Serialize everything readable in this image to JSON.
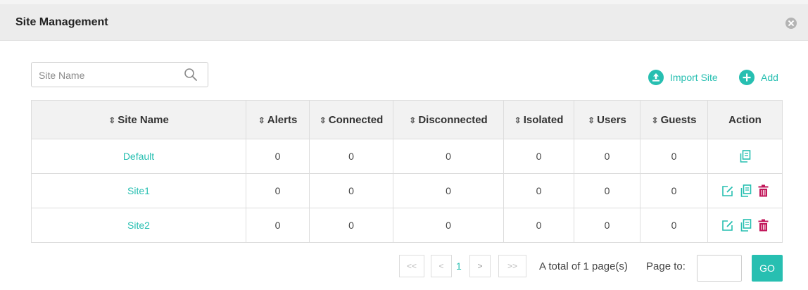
{
  "panel": {
    "title": "Site Management"
  },
  "search": {
    "placeholder": "Site Name"
  },
  "toolbar": {
    "import_label": "Import Site",
    "add_label": "Add"
  },
  "table": {
    "columns": [
      "Site Name",
      "Alerts",
      "Connected",
      "Disconnected",
      "Isolated",
      "Users",
      "Guests",
      "Action"
    ],
    "rows": [
      {
        "name": "Default",
        "alerts": "0",
        "connected": "0",
        "disconnected": "0",
        "isolated": "0",
        "users": "0",
        "guests": "0",
        "actions": [
          "copy"
        ]
      },
      {
        "name": "Site1",
        "alerts": "0",
        "connected": "0",
        "disconnected": "0",
        "isolated": "0",
        "users": "0",
        "guests": "0",
        "actions": [
          "edit",
          "copy",
          "delete"
        ]
      },
      {
        "name": "Site2",
        "alerts": "0",
        "connected": "0",
        "disconnected": "0",
        "isolated": "0",
        "users": "0",
        "guests": "0",
        "actions": [
          "edit",
          "copy",
          "delete"
        ]
      }
    ]
  },
  "pagination": {
    "first": "<<",
    "prev": "<",
    "current": "1",
    "next": ">",
    "last": ">>",
    "total_text": "A total of 1 page(s)",
    "page_to_label": "Page to:",
    "go_label": "GO"
  },
  "icons": {
    "close": "close-icon",
    "search": "search-icon",
    "import": "upload-icon",
    "add": "plus-icon",
    "sort": "sort-icon",
    "edit": "edit-icon",
    "copy": "copy-icon",
    "delete": "trash-icon"
  },
  "colors": {
    "accent": "#27bfb1",
    "delete": "#c2185b",
    "header_bg": "#ececec",
    "table_header_bg": "#f2f2f2"
  }
}
